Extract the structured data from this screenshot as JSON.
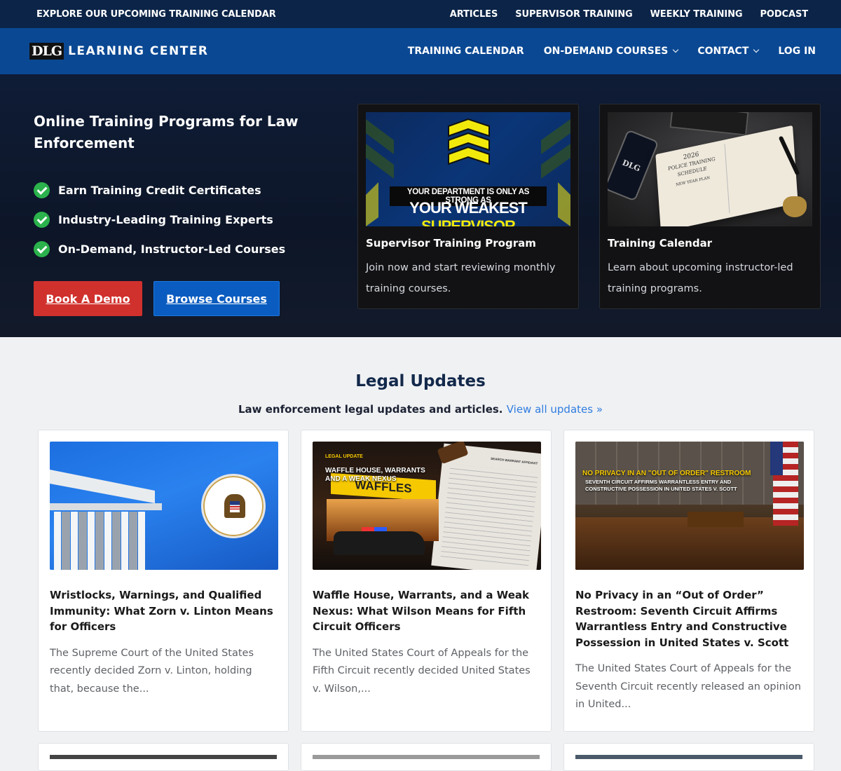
{
  "topbar": {
    "left_link": "EXPLORE OUR UPCOMING TRAINING CALENDAR",
    "links": [
      "ARTICLES",
      "SUPERVISOR TRAINING",
      "WEEKLY TRAINING",
      "PODCAST"
    ]
  },
  "nav": {
    "brand_mark": "DLG",
    "brand_text": "LEARNING CENTER",
    "items": [
      {
        "label": "TRAINING CALENDAR"
      },
      {
        "label": "ON-DEMAND COURSES"
      },
      {
        "label": "CONTACT"
      },
      {
        "label": "LOG IN"
      }
    ]
  },
  "hero": {
    "title": "Online Training Programs for Law Enforcement",
    "checks": [
      "Earn Training Credit Certificates",
      "Industry-Leading Training Experts",
      "On-Demand, Instructor-Led Courses"
    ],
    "primary_button": "Book A Demo",
    "secondary_button": "Browse Courses",
    "cards": [
      {
        "image_line1": "YOUR DEPARTMENT IS ONLY AS STRONG AS",
        "image_line2a": "YOUR WEAKEST",
        "image_line2b": "SUPERVISOR",
        "title": "Supervisor Training Program",
        "text": "Join now and start reviewing monthly training courses."
      },
      {
        "image_phone": "DLG",
        "image_book_line1": "2026",
        "image_book_line2": "POLICE TRAINING",
        "image_book_line3": "SCHEDULE",
        "image_book_line4": "NEW YEAR PLAN",
        "title": "Training Calendar",
        "text": "Learn about upcoming instructor-led training programs."
      }
    ]
  },
  "legal": {
    "title": "Legal Updates",
    "subtitle": "Law enforcement legal updates and articles.",
    "link": "View all updates »",
    "articles": [
      {
        "title": "Wristlocks, Warnings, and Qualified Immunity: What Zorn v. Linton Means for Officers",
        "excerpt": "The Supreme Court of the United States recently decided Zorn v. Linton, holding that, because the..."
      },
      {
        "image_tag": "LEGAL UPDATE",
        "image_line1": "WAFFLE HOUSE, WARRANTS",
        "image_line2": "AND A WEAK NEXUS",
        "image_sign": "WAFFLES",
        "image_doc": "SEARCH WARRANT AFFIDAVIT",
        "title": "Waffle House, Warrants, and a Weak Nexus: What Wilson Means for Fifth Circuit Officers",
        "excerpt": "The United States Court of Appeals for the Fifth Circuit recently decided United States v. Wilson,..."
      },
      {
        "image_line1": "NO PRIVACY IN AN \"OUT OF ORDER\" RESTROOM",
        "image_line2": "SEVENTH CIRCUIT AFFIRMS WARRANTLESS ENTRY AND",
        "image_line3": "CONSTRUCTIVE POSSESSION IN UNITED STATES V. SCOTT",
        "title": "No Privacy in an “Out of Order” Restroom: Seventh Circuit Affirms Warrantless Entry and Constructive Possession in United States v. Scott",
        "excerpt": "The United States Court of Appeals for the Seventh Circuit recently released an opinion in United..."
      }
    ]
  }
}
